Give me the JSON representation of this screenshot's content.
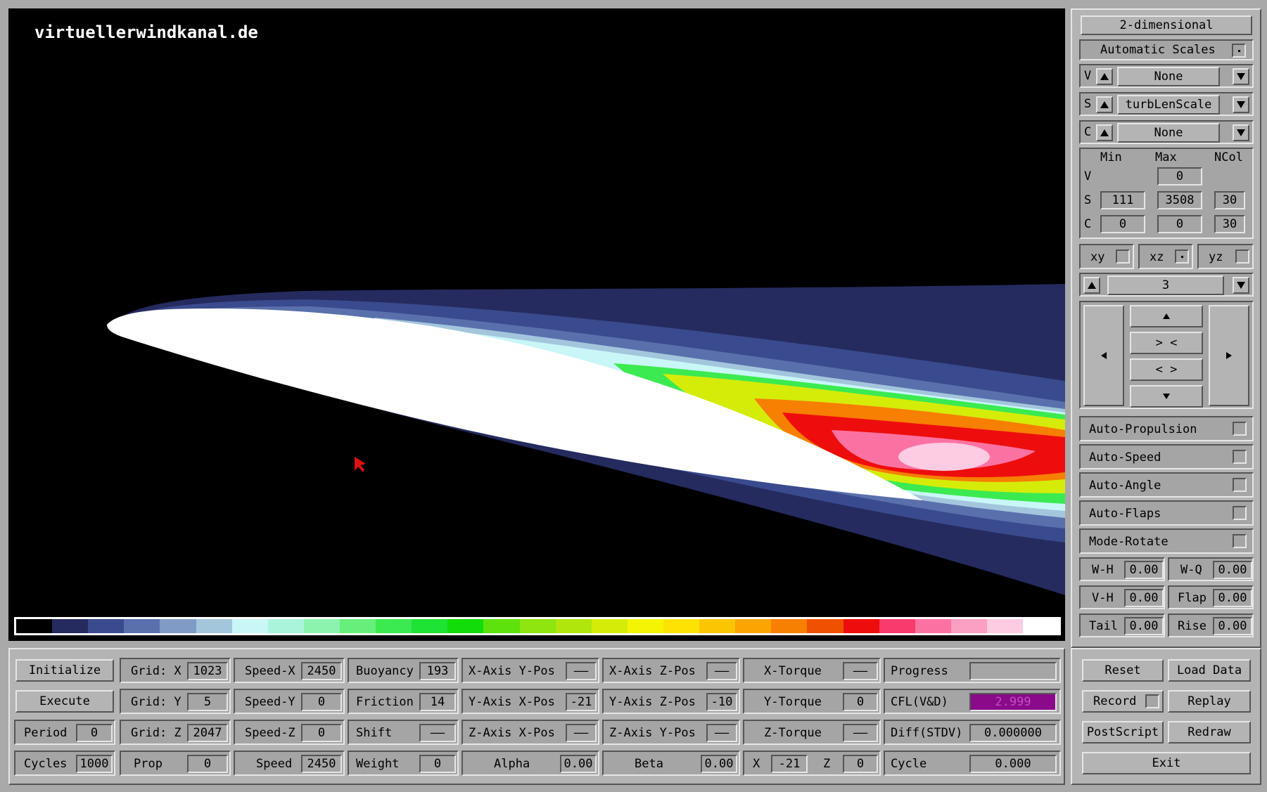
{
  "viewport": {
    "site": "virtuellerwindkanal.de",
    "colorbar": [
      "#000000",
      "#252b5e",
      "#3a4a8e",
      "#5a70ad",
      "#7f9bc6",
      "#a3c6dd",
      "#c9f6f7",
      "#aaf4dc",
      "#8bf3ae",
      "#66ef7a",
      "#3bea50",
      "#1ee234",
      "#12dd0a",
      "#5de20d",
      "#8ee50f",
      "#b0e60c",
      "#d5ec09",
      "#f4f404",
      "#fce304",
      "#fcc503",
      "#fba402",
      "#f77f01",
      "#f05001",
      "#ee0d0d",
      "#f83a6c",
      "#fb72a2",
      "#fb9fc3",
      "#fdcbe2",
      "#ffffff"
    ]
  },
  "right_panel": {
    "mode": "2-dimensional",
    "auto_scales": "Automatic Scales",
    "v_letter": "V",
    "v_value": "None",
    "s_letter": "S",
    "s_value": "turbLenScale",
    "c_letter": "C",
    "c_value": "None",
    "hdr_min": "Min",
    "hdr_max": "Max",
    "hdr_ncol": "NCol",
    "row_v": "V",
    "v_max": "0",
    "row_s": "S",
    "s_min": "111",
    "s_max": "3508",
    "s_ncol": "30",
    "row_c": "C",
    "c_min": "0",
    "c_max": "0",
    "c_ncol": "30",
    "xy": "xy",
    "xz": "xz",
    "yz": "yz",
    "slice": "3",
    "nav_in": "> <",
    "nav_out": "< >",
    "toggles": [
      "Auto-Propulsion",
      "Auto-Speed",
      "Auto-Angle",
      "Auto-Flaps",
      "Mode-Rotate"
    ],
    "wh_label": "W-H",
    "wh_value": "0.00",
    "wq_label": "W-Q",
    "wq_value": "0.00",
    "vh_label": "V-H",
    "vh_value": "0.00",
    "flap_label": "Flap",
    "flap_value": "0.00",
    "tail_label": "Tail",
    "tail_value": "0.00",
    "rise_label": "Rise",
    "rise_value": "0.00"
  },
  "bottom": {
    "initialize": "Initialize",
    "execute": "Execute",
    "period_label": "Period",
    "period_value": "0",
    "cycles_label": "Cycles",
    "cycles_value": "1000",
    "gridx_label": "Grid: X",
    "gridx_value": "1023",
    "gridy_label": "Grid: Y",
    "gridy_value": "5",
    "gridz_label": "Grid: Z",
    "gridz_value": "2047",
    "prop_label": "Prop",
    "prop_value": "0",
    "speedx_label": "Speed-X",
    "speedx_value": "2450",
    "speedy_label": "Speed-Y",
    "speedy_value": "0",
    "speedz_label": "Speed-Z",
    "speedz_value": "0",
    "speed_label": "Speed",
    "speed_value": "2450",
    "buoyancy_label": "Buoyancy",
    "buoyancy_value": "193",
    "friction_label": "Friction",
    "friction_value": "14",
    "shift_label": "Shift",
    "shift_value": "——",
    "weight_label": "Weight",
    "weight_value": "0",
    "xaxis_ypos_label": "X-Axis Y-Pos",
    "xaxis_ypos_value": "——",
    "yaxis_xpos_label": "Y-Axis X-Pos",
    "yaxis_xpos_value": "-21",
    "zaxis_xpos_label": "Z-Axis X-Pos",
    "zaxis_xpos_value": "——",
    "alpha_label": "Alpha",
    "alpha_value": "0.00",
    "xaxis_zpos_label": "X-Axis Z-Pos",
    "xaxis_zpos_value": "——",
    "yaxis_zpos_label": "Y-Axis Z-Pos",
    "yaxis_zpos_value": "-10",
    "zaxis_ypos_label": "Z-Axis Y-Pos",
    "zaxis_ypos_value": "——",
    "beta_label": "Beta",
    "beta_value": "0.00",
    "xtorque_label": "X-Torque",
    "xtorque_value": "——",
    "ytorque_label": "Y-Torque",
    "ytorque_value": "0",
    "ztorque_label": "Z-Torque",
    "ztorque_value": "——",
    "x_label": "X",
    "x_value": "-21",
    "z_label": "Z",
    "z_value": "0",
    "progress_label": "Progress",
    "progress_fraction": 0.0,
    "cfl_label": "CFL(V&D)",
    "cfl_value": "2.999",
    "cfl_color": "#8a0a8a",
    "diff_label": "Diff(STDV)",
    "diff_value": "0.000000",
    "cycle_label": "Cycle",
    "cycle_value": "0.000",
    "reset": "Reset",
    "load_data": "Load Data",
    "record": "Record",
    "replay": "Replay",
    "postscript": "PostScript",
    "redraw": "Redraw",
    "exit": "Exit"
  }
}
